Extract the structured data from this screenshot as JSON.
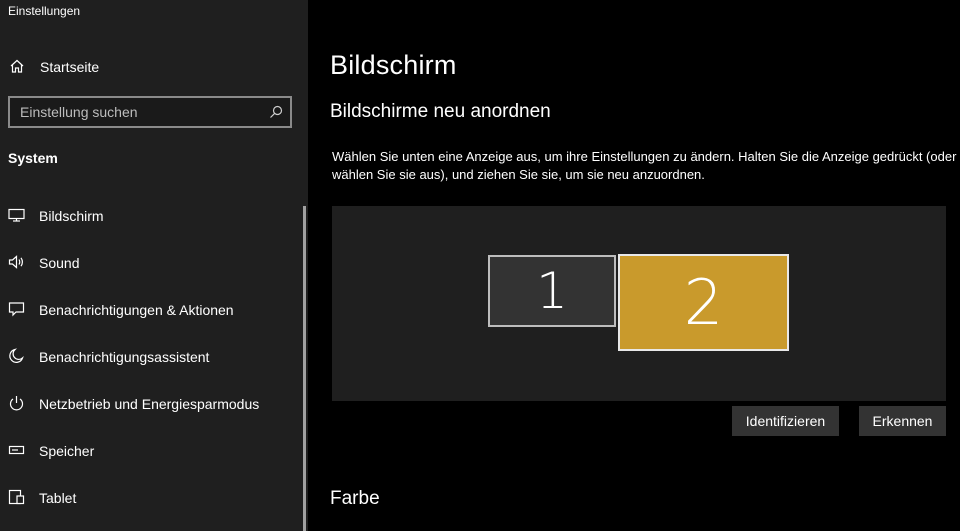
{
  "app": {
    "title": "Einstellungen"
  },
  "sidebar": {
    "home": {
      "label": "Startseite",
      "icon": "home-icon"
    },
    "search": {
      "placeholder": "Einstellung suchen",
      "icon": "search-icon"
    },
    "section": "System",
    "items": [
      {
        "label": "Bildschirm",
        "icon": "monitor-icon"
      },
      {
        "label": "Sound",
        "icon": "speaker-icon"
      },
      {
        "label": "Benachrichtigungen & Aktionen",
        "icon": "message-icon"
      },
      {
        "label": "Benachrichtigungsassistent",
        "icon": "moon-icon"
      },
      {
        "label": "Netzbetrieb und Energiesparmodus",
        "icon": "power-icon"
      },
      {
        "label": "Speicher",
        "icon": "storage-icon"
      },
      {
        "label": "Tablet",
        "icon": "tablet-icon"
      }
    ]
  },
  "main": {
    "title": "Bildschirm",
    "subtitle": "Bildschirme neu anordnen",
    "description": "Wählen Sie unten eine Anzeige aus, um ihre Einstellungen zu ändern. Halten Sie die Anzeige gedrückt (oder wählen Sie sie aus), und ziehen Sie sie, um sie neu anzuordnen.",
    "monitors": [
      {
        "label": "1",
        "color": "#333333"
      },
      {
        "label": "2",
        "color": "#c99a2c"
      }
    ],
    "buttons": {
      "identify": "Identifizieren",
      "detect": "Erkennen"
    },
    "next_section": "Farbe"
  }
}
